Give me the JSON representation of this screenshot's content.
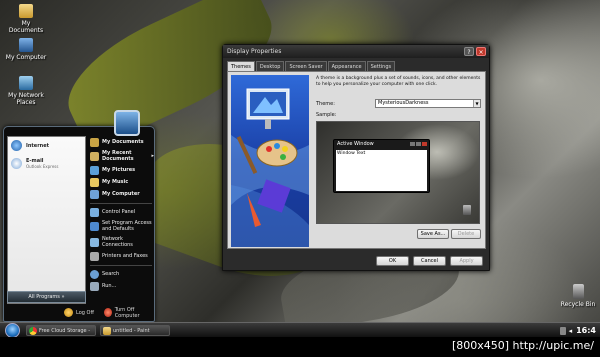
{
  "desktop": {
    "icons": [
      {
        "label": "My Documents",
        "icon": "folder-icon"
      },
      {
        "label": "My Computer",
        "icon": "computer-icon"
      },
      {
        "label": "My Network Places",
        "icon": "network-icon"
      },
      {
        "label": "Recycle Bin",
        "icon": "recycle-bin-icon"
      }
    ]
  },
  "start_menu": {
    "pinned": [
      {
        "label": "Internet",
        "sub": "",
        "icon": "browser-icon"
      },
      {
        "label": "E-mail",
        "sub": "Outlook Express",
        "icon": "mail-icon"
      }
    ],
    "all_programs": "All Programs",
    "right_items": [
      {
        "label": "My Documents",
        "icon": "documents-icon"
      },
      {
        "label": "My Recent Documents",
        "icon": "recent-documents-icon"
      },
      {
        "label": "My Pictures",
        "icon": "pictures-icon"
      },
      {
        "label": "My Music",
        "icon": "music-icon"
      },
      {
        "label": "My Computer",
        "icon": "computer-icon"
      },
      {
        "label": "Control Panel",
        "icon": "control-panel-icon"
      },
      {
        "label": "Set Program Access and Defaults",
        "icon": "program-defaults-icon"
      },
      {
        "label": "Network Connections",
        "icon": "network-connections-icon"
      },
      {
        "label": "Printers and Faxes",
        "icon": "printer-icon"
      },
      {
        "label": "Search",
        "icon": "search-icon"
      },
      {
        "label": "Run...",
        "icon": "run-icon"
      }
    ],
    "log_off": "Log Off",
    "turn_off": "Turn Off Computer"
  },
  "dialog": {
    "title": "Display Properties",
    "title_buttons": {
      "help": "?",
      "close": "×"
    },
    "tabs": [
      "Themes",
      "Desktop",
      "Screen Saver",
      "Appearance",
      "Settings"
    ],
    "active_tab": "Themes",
    "description": "A theme is a background plus a set of sounds, icons, and other elements to help you personalize your computer with one click.",
    "theme_label": "Theme:",
    "theme_value": "MysteriousDarkness",
    "sample_label": "Sample:",
    "sample_window": {
      "title": "Active Window",
      "body_text": "Window Text"
    },
    "save_as": "Save As...",
    "delete": "Delete",
    "ok": "OK",
    "cancel": "Cancel",
    "apply": "Apply"
  },
  "taskbar": {
    "tasks": [
      {
        "label": "Free Cloud Storage - Me...",
        "icon": "chrome-icon"
      },
      {
        "label": "untitled - Paint",
        "icon": "paint-icon"
      }
    ],
    "clock": "16:4"
  },
  "watermark": "[800x450] http://upic.me/",
  "colors": {
    "accent_blue": "#2f6ad8",
    "close_red": "#c0392b",
    "taskbar": "#101010"
  }
}
